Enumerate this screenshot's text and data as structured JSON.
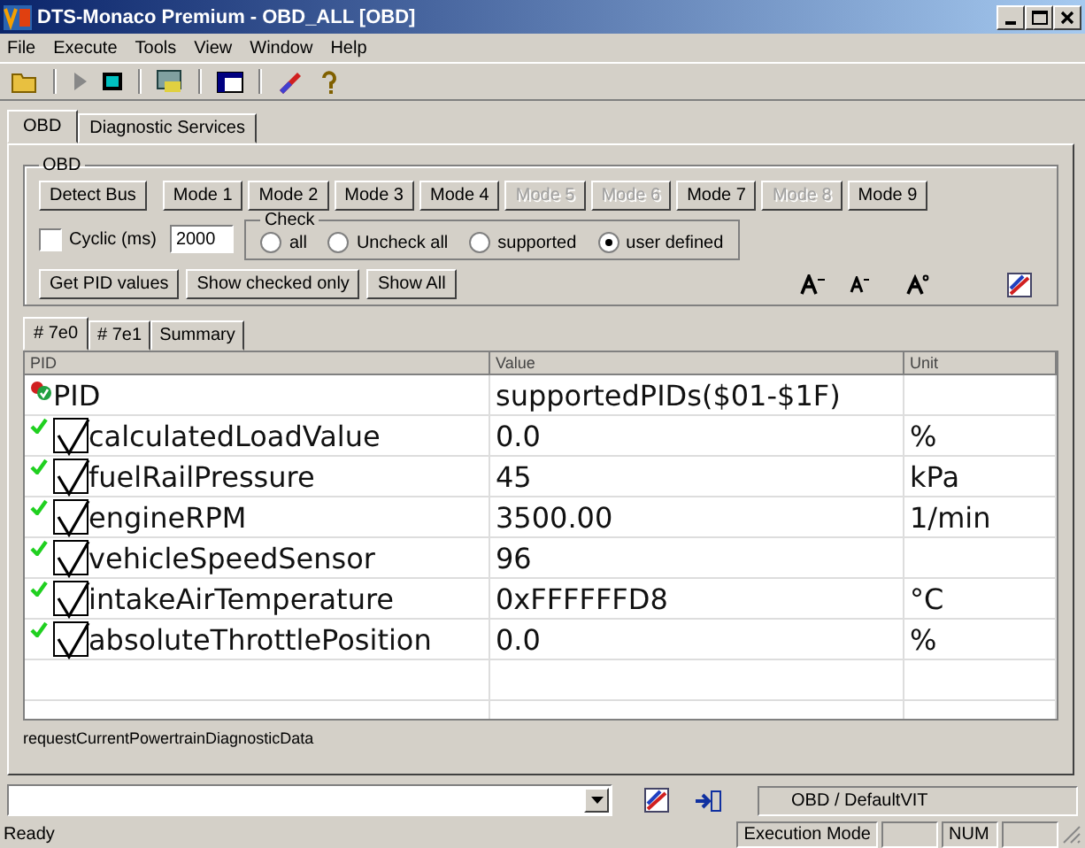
{
  "window": {
    "title": "DTS-Monaco Premium - OBD_ALL [OBD]"
  },
  "menu": [
    "File",
    "Execute",
    "Tools",
    "View",
    "Window",
    "Help"
  ],
  "tabs": [
    {
      "label": "OBD",
      "selected": true
    },
    {
      "label": "Diagnostic Services",
      "selected": false
    }
  ],
  "group": {
    "title": "OBD",
    "mode_buttons": [
      {
        "label": "Detect Bus",
        "disabled": false
      },
      {
        "label": "Mode 1",
        "disabled": false
      },
      {
        "label": "Mode 2",
        "disabled": false
      },
      {
        "label": "Mode 3",
        "disabled": false
      },
      {
        "label": "Mode 4",
        "disabled": false
      },
      {
        "label": "Mode 5",
        "disabled": true
      },
      {
        "label": "Mode 6",
        "disabled": true
      },
      {
        "label": "Mode 7",
        "disabled": false
      },
      {
        "label": "Mode 8",
        "disabled": true
      },
      {
        "label": "Mode 9",
        "disabled": false
      }
    ],
    "cyclic": {
      "label": "Cyclic (ms)",
      "checked": false,
      "value": "2000"
    },
    "check": {
      "title": "Check",
      "options": [
        {
          "label": "all",
          "selected": false
        },
        {
          "label": "Uncheck all",
          "selected": false
        },
        {
          "label": "supported",
          "selected": false
        },
        {
          "label": "user defined",
          "selected": true
        }
      ]
    },
    "action_buttons": [
      "Get PID values",
      "Show checked only",
      "Show All"
    ]
  },
  "sub_tabs": [
    {
      "label": "# 7e0",
      "selected": true
    },
    {
      "label": "# 7e1",
      "selected": false
    },
    {
      "label": "Summary",
      "selected": false
    }
  ],
  "table": {
    "columns": [
      "PID",
      "Value",
      "Unit"
    ],
    "rows": [
      {
        "kind": "group",
        "pid": "PID",
        "value": "supportedPIDs($01-$1F)"
      },
      {
        "kind": "item",
        "checked": true,
        "pid": "calculatedLoadValue",
        "value": "0.0",
        "unit": "%"
      },
      {
        "kind": "item",
        "checked": true,
        "pid": "fuelRailPressure",
        "value": "45",
        "unit": "kPa"
      },
      {
        "kind": "item",
        "checked": true,
        "pid": "engineRPM",
        "value": "3500.00",
        "unit": "1/min"
      },
      {
        "kind": "item",
        "checked": true,
        "pid": "vehicleSpeedSensor",
        "value": "96"
      },
      {
        "kind": "item",
        "checked": true,
        "pid": "intakeAirTemperature",
        "value": "0xFFFFFFD8",
        "unit": "°C"
      },
      {
        "kind": "item",
        "checked": true,
        "pid": "absoluteThrottlePosition",
        "value": "0.0",
        "unit": "%"
      }
    ]
  },
  "service_name": "requestCurrentPowertrainDiagnosticData",
  "bottom_bar": {
    "vit": "OBD / DefaultVIT"
  },
  "status_bar": {
    "message": "Ready",
    "mode": "Execution Mode",
    "num": "NUM"
  }
}
